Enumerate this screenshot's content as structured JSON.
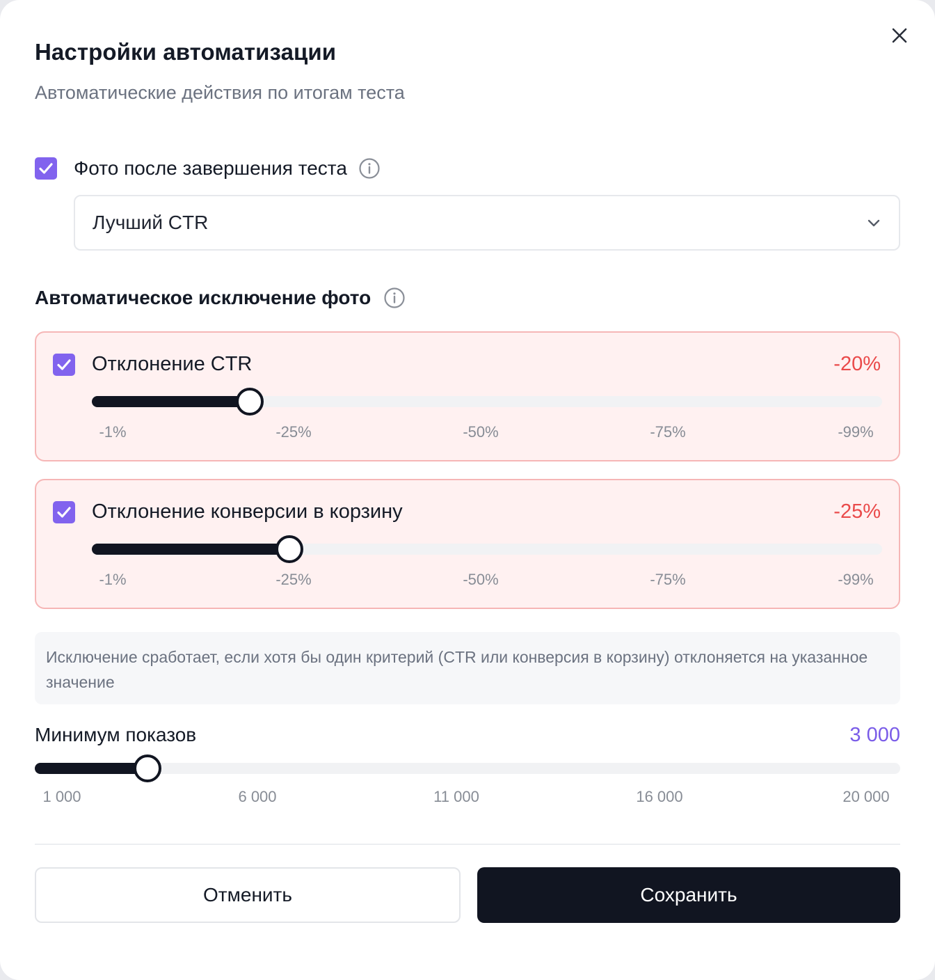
{
  "dialog": {
    "title": "Настройки автоматизации",
    "subtitle": "Автоматические действия по итогам теста"
  },
  "photo_after_test": {
    "checked": true,
    "label": "Фото после завершения теста",
    "select_value": "Лучший CTR"
  },
  "auto_exclusion": {
    "title": "Автоматическое исключение фото",
    "criteria": [
      {
        "checked": true,
        "label": "Отклонение CTR",
        "value_text": "-20%",
        "value_percent": 20,
        "ticks": [
          "-1%",
          "-25%",
          "-50%",
          "-75%",
          "-99%"
        ]
      },
      {
        "checked": true,
        "label": "Отклонение конверсии в корзину",
        "value_text": "-25%",
        "value_percent": 25,
        "ticks": [
          "-1%",
          "-25%",
          "-50%",
          "-75%",
          "-99%"
        ]
      }
    ],
    "note": "Исключение сработает, если хотя бы один критерий (CTR или конверсия в корзину) отклоняется на указанное значение"
  },
  "min_impressions": {
    "label": "Минимум показов",
    "value_text": "3 000",
    "value": 3000,
    "min": 1000,
    "max": 20000,
    "ticks": [
      "1 000",
      "6 000",
      "11 000",
      "16 000",
      "20 000"
    ]
  },
  "buttons": {
    "cancel": "Отменить",
    "save": "Сохранить"
  },
  "colors": {
    "accent": "#8163ee",
    "danger": "#ea4a4a",
    "dark": "#111521"
  },
  "icons": {
    "close": "close-icon",
    "info": "info-icon",
    "check": "check-icon",
    "chevron": "chevron-down-icon"
  }
}
